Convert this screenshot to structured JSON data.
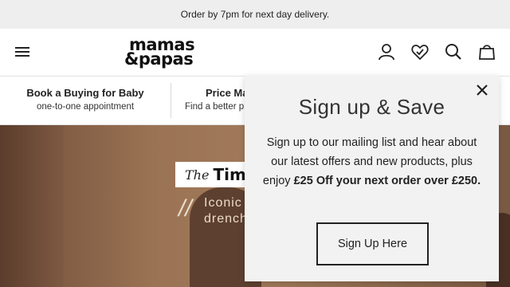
{
  "promo": {
    "text": "Order by 7pm for next day delivery."
  },
  "header": {
    "logo_line1": "mamas",
    "logo_line2": "&papas",
    "icons": [
      "menu-icon",
      "account-icon",
      "wishlist-heart-icon",
      "search-icon",
      "bag-icon"
    ]
  },
  "usp": [
    {
      "title": "Book a Buying for Baby",
      "subtitle": "one-to-one appointment"
    },
    {
      "title": "Price Ma",
      "subtitle": "Find a better p"
    }
  ],
  "hero": {
    "tag_prefix": "The",
    "tag_title": "Tim",
    "slashes": "//",
    "copy_line1": "Iconic",
    "copy_line2": "drench"
  },
  "popup": {
    "title": "Sign up & Save",
    "body_text": "Sign up to our mailing list and hear about our latest offers and new products, plus enjoy ",
    "body_bold": "£25 Off your next order over £250.",
    "button_label": "Sign Up Here"
  },
  "colors": {
    "popup_bg": "#f2f2f2",
    "promo_bg": "#eeeeee",
    "hero_brown": "#8a6449"
  }
}
